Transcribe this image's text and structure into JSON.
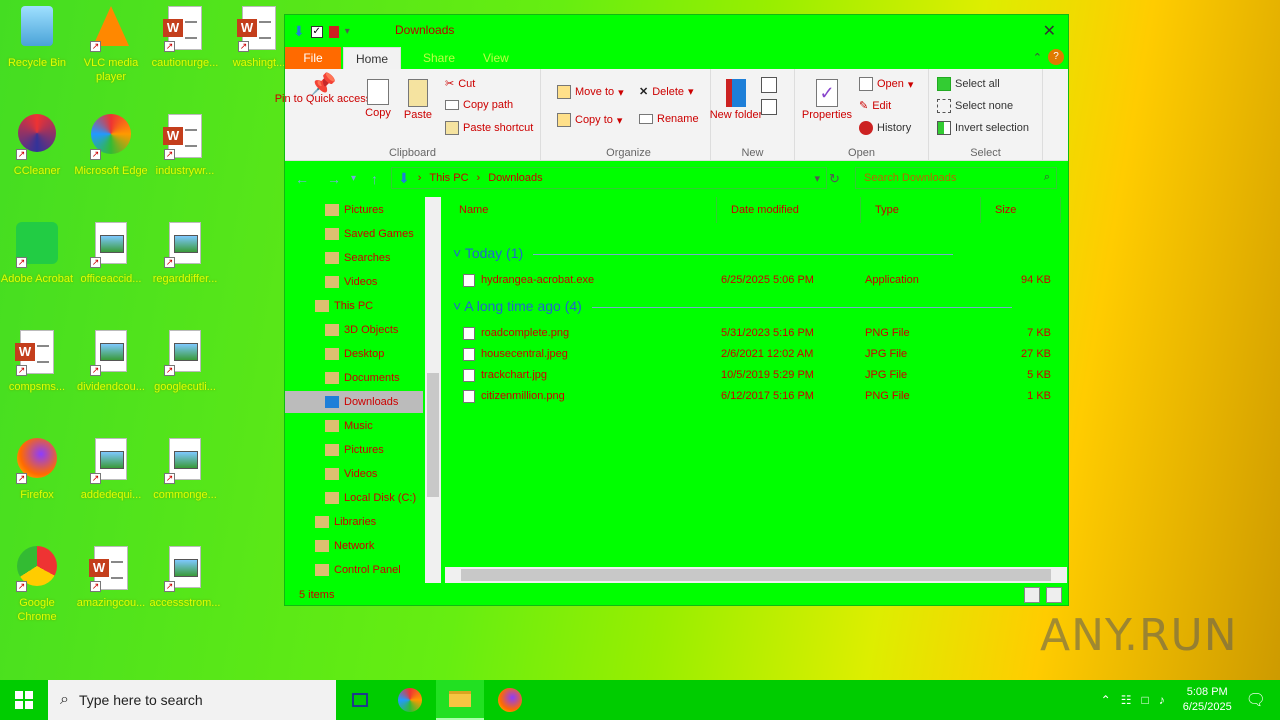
{
  "desktop": {
    "icons": [
      {
        "label": "Recycle Bin",
        "kind": "recycle"
      },
      {
        "label": "VLC media player",
        "kind": "vlc"
      },
      {
        "label": "cautionurge...",
        "kind": "word"
      },
      {
        "label": "washingt...",
        "kind": "word"
      },
      {
        "label": "CCleaner",
        "kind": "ccleaner"
      },
      {
        "label": "Microsoft Edge",
        "kind": "edge"
      },
      {
        "label": "industrywr...",
        "kind": "word"
      },
      {
        "label": "Adobe Acrobat",
        "kind": "acrobat"
      },
      {
        "label": "officeaccid...",
        "kind": "image"
      },
      {
        "label": "regarddiffer...",
        "kind": "image"
      },
      {
        "label": "compsms...",
        "kind": "word"
      },
      {
        "label": "dividendcou...",
        "kind": "image"
      },
      {
        "label": "googlecutli...",
        "kind": "image"
      },
      {
        "label": "Firefox",
        "kind": "firefox"
      },
      {
        "label": "addedequi...",
        "kind": "image"
      },
      {
        "label": "commonge...",
        "kind": "image"
      },
      {
        "label": "Google Chrome",
        "kind": "chrome"
      },
      {
        "label": "amazingcou...",
        "kind": "word"
      },
      {
        "label": "accessstrom...",
        "kind": "image"
      }
    ]
  },
  "window": {
    "title": "Downloads",
    "tabs": {
      "file": "File",
      "home": "Home",
      "share": "Share",
      "view": "View"
    },
    "ribbon": {
      "clipboard": {
        "name": "Clipboard",
        "pin": "Pin to Quick access",
        "copy": "Copy",
        "paste": "Paste",
        "cut": "Cut",
        "copy_path": "Copy path",
        "paste_shortcut": "Paste shortcut"
      },
      "organize": {
        "name": "Organize",
        "move_to": "Move to",
        "copy_to": "Copy to",
        "delete": "Delete",
        "rename": "Rename"
      },
      "new": {
        "name": "New",
        "new_folder": "New folder"
      },
      "open": {
        "name": "Open",
        "properties": "Properties",
        "open": "Open",
        "edit": "Edit",
        "history": "History"
      },
      "select": {
        "name": "Select",
        "select_all": "Select all",
        "select_none": "Select none",
        "invert": "Invert selection"
      }
    },
    "address": {
      "crumbs": [
        "This PC",
        "Downloads"
      ],
      "search_placeholder": "Search Downloads"
    },
    "nav": [
      {
        "label": "Pictures",
        "indent": 1
      },
      {
        "label": "Saved Games",
        "indent": 1
      },
      {
        "label": "Searches",
        "indent": 1
      },
      {
        "label": "Videos",
        "indent": 1
      },
      {
        "label": "This PC",
        "indent": 0
      },
      {
        "label": "3D Objects",
        "indent": 1
      },
      {
        "label": "Desktop",
        "indent": 1
      },
      {
        "label": "Documents",
        "indent": 1
      },
      {
        "label": "Downloads",
        "indent": 1,
        "selected": true
      },
      {
        "label": "Music",
        "indent": 1
      },
      {
        "label": "Pictures",
        "indent": 1
      },
      {
        "label": "Videos",
        "indent": 1
      },
      {
        "label": "Local Disk (C:)",
        "indent": 1
      },
      {
        "label": "Libraries",
        "indent": 0
      },
      {
        "label": "Network",
        "indent": 0
      },
      {
        "label": "Control Panel",
        "indent": 0
      }
    ],
    "columns": {
      "name": "Name",
      "date": "Date modified",
      "type": "Type",
      "size": "Size"
    },
    "groups": [
      {
        "label": "Today (1)",
        "files": [
          {
            "name": "hydrangea-acrobat.exe",
            "date": "6/25/2025 5:06 PM",
            "type": "Application",
            "size": "94 KB"
          }
        ]
      },
      {
        "label": "A long time ago (4)",
        "files": [
          {
            "name": "roadcomplete.png",
            "date": "5/31/2023 5:16 PM",
            "type": "PNG File",
            "size": "7 KB"
          },
          {
            "name": "housecentral.jpeg",
            "date": "2/6/2021 12:02 AM",
            "type": "JPG File",
            "size": "27 KB"
          },
          {
            "name": "trackchart.jpg",
            "date": "10/5/2019 5:29 PM",
            "type": "JPG File",
            "size": "5 KB"
          },
          {
            "name": "citizenmillion.png",
            "date": "6/12/2017 5:16 PM",
            "type": "PNG File",
            "size": "1 KB"
          }
        ]
      }
    ],
    "status": "5 items"
  },
  "taskbar": {
    "search_placeholder": "Type here to search",
    "time": "5:08 PM",
    "date": "6/25/2025"
  },
  "watermark": "ANY.RUN"
}
